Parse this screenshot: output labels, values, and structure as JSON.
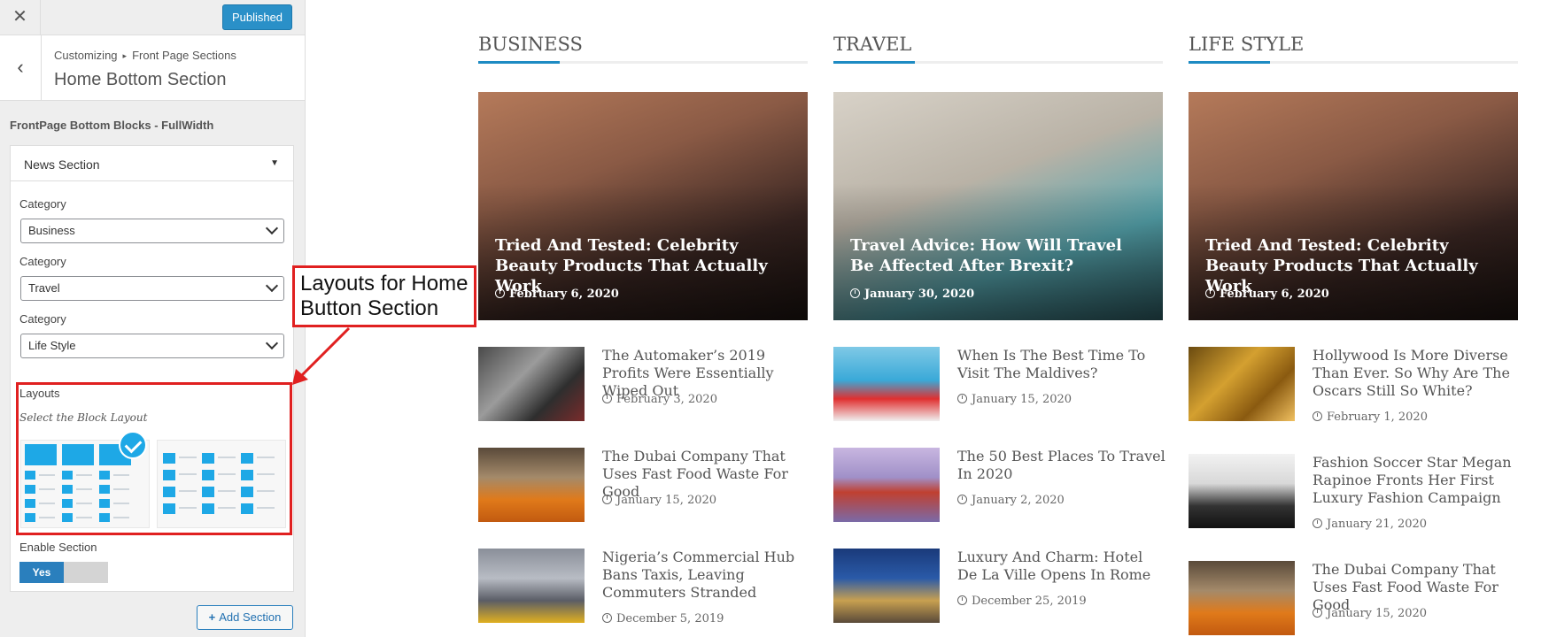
{
  "topbar": {
    "close_glyph": "✕",
    "publish_label": "Published"
  },
  "section_header": {
    "breadcrumb_root": "Customizing",
    "breadcrumb_sep": "▸",
    "breadcrumb_parent": "Front Page Sections",
    "title": "Home Bottom Section",
    "back_glyph": "‹"
  },
  "blocks_title": "FrontPage Bottom Blocks - FullWidth",
  "panel": {
    "accordion_title": "News Section",
    "accordion_caret": "▼",
    "fields": [
      {
        "label": "Category",
        "value": "Business"
      },
      {
        "label": "Category",
        "value": "Travel"
      },
      {
        "label": "Category",
        "value": "Life Style"
      }
    ],
    "layouts_label": "Layouts",
    "layouts_desc": "Select the Block Layout",
    "selected_layout": 1,
    "enable_label": "Enable Section",
    "enable_value": "Yes"
  },
  "add_section": {
    "plus": "+",
    "label": "Add Section"
  },
  "annotation": {
    "text": "Layouts for Home Button Section",
    "color": "#e02020"
  },
  "accent_color": "#1e8bc3",
  "columns": [
    {
      "title": "BUSINESS",
      "hero": {
        "title": "Tried And Tested: Celebrity Beauty Products That Actually Work",
        "date": "February 6, 2020"
      },
      "items": [
        {
          "title": "The Automaker’s 2019 Profits Were Essentially Wiped Out",
          "date": "February 3, 2020"
        },
        {
          "title": "The Dubai Company That Uses Fast Food Waste For Good",
          "date": "January 15, 2020"
        },
        {
          "title": "Nigeria’s Commercial Hub Bans Taxis, Leaving Commuters Stranded",
          "date": "December 5, 2019"
        }
      ]
    },
    {
      "title": "TRAVEL",
      "hero": {
        "title": "Travel Advice: How Will Travel Be Affected After Brexit?",
        "date": "January 30, 2020"
      },
      "items": [
        {
          "title": "When Is The Best Time To Visit The Maldives?",
          "date": "January 15, 2020"
        },
        {
          "title": "The 50 Best Places To Travel In 2020",
          "date": "January 2, 2020"
        },
        {
          "title": "Luxury And Charm: Hotel De La Ville Opens In Rome",
          "date": "December 25, 2019"
        }
      ]
    },
    {
      "title": "LIFE STYLE",
      "hero": {
        "title": "Tried And Tested: Celebrity Beauty Products That Actually Work",
        "date": "February 6, 2020"
      },
      "items": [
        {
          "title": "Hollywood Is More Diverse Than Ever. So Why Are The Oscars Still So White?",
          "date": "February 1, 2020"
        },
        {
          "title": "Fashion Soccer Star Megan Rapinoe Fronts Her First Luxury Fashion Campaign",
          "date": "January 21, 2020"
        },
        {
          "title": "The Dubai Company That Uses Fast Food Waste For Good",
          "date": "January 15, 2020"
        }
      ]
    }
  ]
}
